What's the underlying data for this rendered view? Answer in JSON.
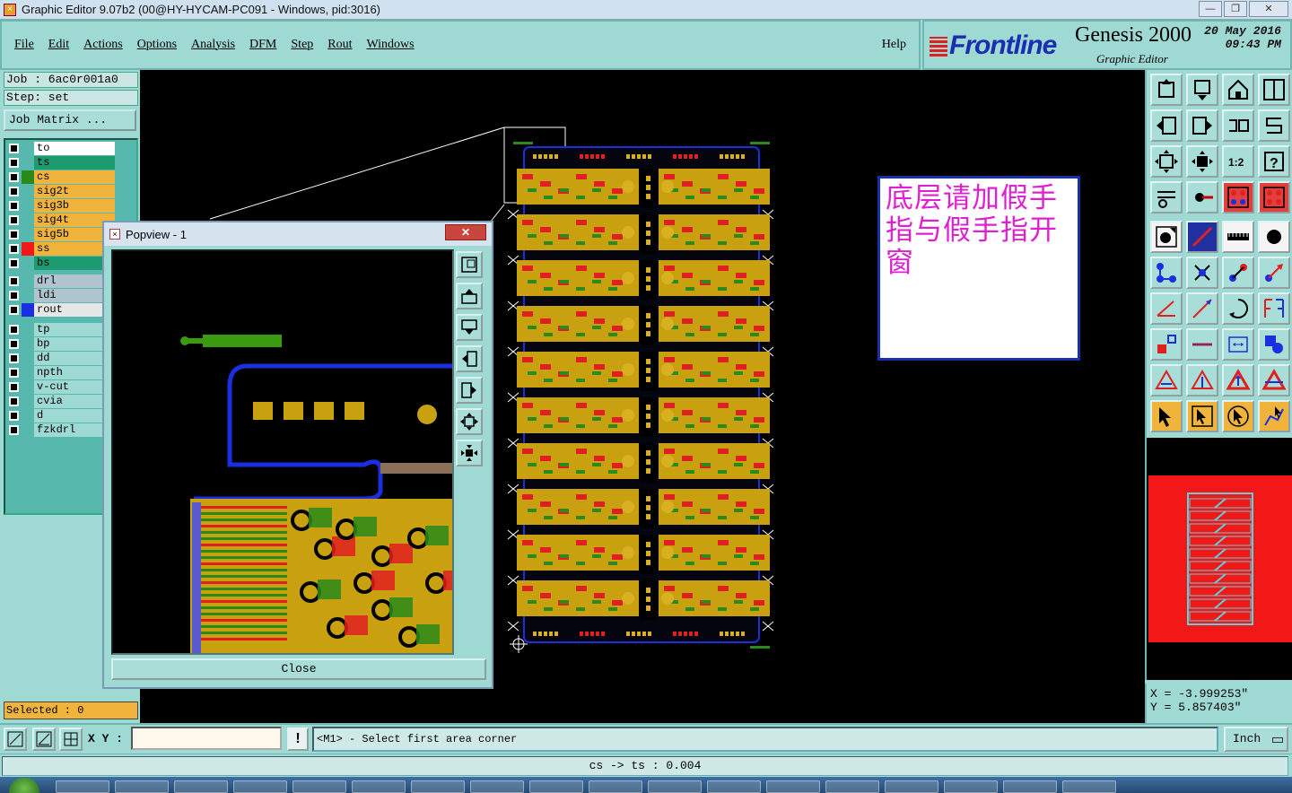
{
  "window": {
    "title": "Graphic Editor 9.07b2 (00@HY-HYCAM-PC091 - Windows, pid:3016)",
    "controls": [
      "minimize",
      "maximize",
      "close"
    ]
  },
  "menubar": {
    "items": [
      "File",
      "Edit",
      "Actions",
      "Options",
      "Analysis",
      "DFM",
      "Step",
      "Rout",
      "Windows"
    ],
    "help": "Help"
  },
  "brand": {
    "logo": "Frontline",
    "product": "Genesis 2000",
    "subtitle": "Graphic Editor",
    "date": "20 May 2016",
    "time": "09:43 PM"
  },
  "job": {
    "job_line": "Job : 6ac0r001a0",
    "step_line": "Step: set",
    "matrix_button": "Job Matrix ..."
  },
  "layers": [
    {
      "name": "to",
      "bg": "#ffffff",
      "swatch": ""
    },
    {
      "name": "ts",
      "bg": "#1e9a70",
      "swatch": ""
    },
    {
      "name": "cs",
      "bg": "#f0b43c",
      "swatch": "#2a8a1a"
    },
    {
      "name": "sig2t",
      "bg": "#f0b43c",
      "swatch": ""
    },
    {
      "name": "sig3b",
      "bg": "#f0b43c",
      "swatch": ""
    },
    {
      "name": "sig4t",
      "bg": "#f0b43c",
      "swatch": ""
    },
    {
      "name": "sig5b",
      "bg": "#f0b43c",
      "swatch": ""
    },
    {
      "name": "ss",
      "bg": "#f0b43c",
      "swatch": "#f01818"
    },
    {
      "name": "bs",
      "bg": "#1e9a70",
      "swatch": ""
    },
    {
      "name": "drl",
      "bg": "#b0c4cf",
      "swatch": ""
    },
    {
      "name": "ldi",
      "bg": "#b0c4cf",
      "swatch": ""
    },
    {
      "name": "rout",
      "bg": "#e6e6e6",
      "swatch": "#1a2fe0"
    },
    {
      "name": "tp",
      "bg": "#9fd9d4",
      "swatch": ""
    },
    {
      "name": "bp",
      "bg": "#9fd9d4",
      "swatch": ""
    },
    {
      "name": "dd",
      "bg": "#9fd9d4",
      "swatch": ""
    },
    {
      "name": "npth",
      "bg": "#9fd9d4",
      "swatch": ""
    },
    {
      "name": "v-cut",
      "bg": "#9fd9d4",
      "swatch": ""
    },
    {
      "name": "cvia",
      "bg": "#9fd9d4",
      "swatch": ""
    },
    {
      "name": "d",
      "bg": "#9fd9d4",
      "swatch": ""
    },
    {
      "name": "fzkdrl",
      "bg": "#9fd9d4",
      "swatch": ""
    }
  ],
  "selected": "Selected : 0",
  "note": "底层请加假手指与假手指开窗",
  "popview": {
    "title": "Popview - 1",
    "close_label": "Close",
    "tools": [
      "zoom-fit-icon",
      "pan-up-icon",
      "pan-down-icon",
      "pan-left-icon",
      "pan-right-icon",
      "zoom-in-icon",
      "zoom-out-icon"
    ]
  },
  "toolbar": {
    "rows": [
      [
        "zoom-home-icon",
        "zoom-back-icon",
        "zoom-house-icon",
        "split-view-icon"
      ],
      [
        "pan-left-icon",
        "pan-right-icon",
        "redo-icon",
        "snap-icon"
      ],
      [
        "fit-all-icon",
        "center-icon",
        "scale-1-2-icon",
        "help-icon"
      ],
      [
        "measure-icon",
        "probe-icon",
        "layers-red-icon",
        "layers-white-icon"
      ],
      [
        "select-pad-icon",
        "select-line-icon",
        "ruler-icon",
        "circle-icon"
      ],
      [
        "node-icon",
        "cross-icon",
        "connect-icon",
        "arrow-connect-icon"
      ],
      [
        "angle-icon",
        "diagonal-icon",
        "arc-icon",
        "mirror-icon"
      ],
      [
        "pad-line-icon",
        "line-icon",
        "dimension-icon",
        "group-icon"
      ],
      [
        "polygon-icon",
        "polygon-arrow-icon",
        "polygon-up-icon",
        "polygon-blue-icon"
      ],
      [
        "pointer-icon",
        "pointer-box-icon",
        "pointer-circle-icon",
        "pointer-path-icon"
      ]
    ],
    "one_to_two_label": "1:2",
    "help_label": "?"
  },
  "coords": {
    "x": "X = -3.999253\"",
    "y": "Y =  5.857403\""
  },
  "bottom": {
    "xy_label": "X Y :",
    "xy_value": "",
    "message": "<M1> - Select first area corner",
    "units": "Inch",
    "status": "cs -> ts : 0.004"
  }
}
